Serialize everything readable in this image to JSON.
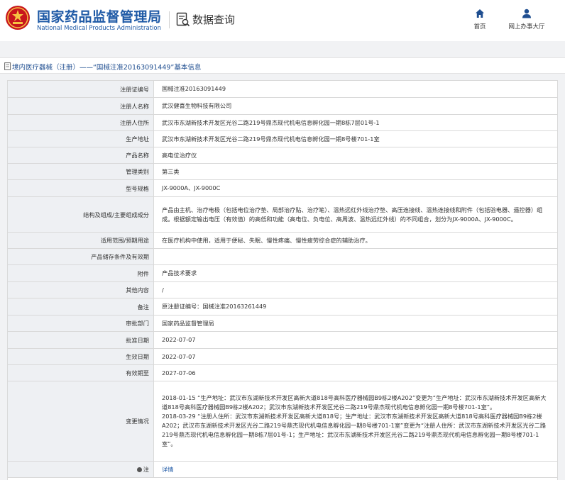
{
  "header": {
    "brand_cn": "国家药品监督管理局",
    "brand_en": "National Medical Products Administration",
    "query_title": "数据查询",
    "nav_home": "首页",
    "nav_hall": "网上办事大厅",
    "brand_color": "#1f5aa6"
  },
  "title_bar": {
    "text": "境内医疗器械（注册）——“国械注准20163091449”基本信息"
  },
  "rows": [
    {
      "label": "注册证编号",
      "value": "国械注准20163091449"
    },
    {
      "label": "注册人名称",
      "value": "武汉健喜生物科技有限公司"
    },
    {
      "label": "注册人住所",
      "value": "武汉市东湖新技术开发区光谷二路219号鼎杰现代机电信息孵化园一期8栋7层01号-1"
    },
    {
      "label": "生产地址",
      "value": "武汉市东湖新技术开发区光谷二路219号鼎杰现代机电信息孵化园一期8号楼701-1室"
    },
    {
      "label": "产品名称",
      "value": "高电位治疗仪"
    },
    {
      "label": "管理类别",
      "value": "第三类"
    },
    {
      "label": "型号规格",
      "value": "JX-9000A、JX-9000C"
    },
    {
      "label": "结构及组成/主要组成成分",
      "value": "产品由主机、治疗电极（包括电位治疗垫、局部治疗贴、治疗笔）、温热远红外线治疗垫、高压连接线、温热连接线和附件（包括验电器、遥控器）组成。根据额定输出电压（有效值）的高低和功能（高电位、负电位、高周波、温热远红外线）的不同组合，划分为JX-9000A、JX-9000C。"
    },
    {
      "label": "适用范围/预期用途",
      "value": "在医疗机构中使用，适用于便秘、失眠、慢性疼痛、慢性疲劳综合症的辅助治疗。"
    },
    {
      "label": "产品储存条件及有效期",
      "value": ""
    },
    {
      "label": "附件",
      "value": "产品技术要求"
    },
    {
      "label": "其他内容",
      "value": "/"
    },
    {
      "label": "备注",
      "value": "原注册证编号：国械注准20163261449"
    },
    {
      "label": "审批部门",
      "value": "国家药品监督管理局"
    },
    {
      "label": "批准日期",
      "value": "2022-07-07"
    },
    {
      "label": "生效日期",
      "value": "2022-07-07"
    },
    {
      "label": "有效期至",
      "value": "2027-07-06"
    },
    {
      "label": "变更情况",
      "value": "2018-01-15 “生产地址：武汉市东湖新技术开发区高新大道818号高科医疗器械园B9栋2楼A202”变更为“生产地址：武汉市东湖新技术开发区高新大道818号高科医疗器械园B9栋2楼A202；武汉市东湖新技术开发区光谷二路219号鼎杰现代机电信息孵化园一期8号楼701-1室”。\n2018-03-29 “注册人住所：武汉市东湖新技术开发区高新大道818号；生产地址：武汉市东湖新技术开发区高新大道818号高科医疗器械园B9栋2楼A202；武汉市东湖新技术开发区光谷二路219号鼎杰现代机电信息孵化园一期8号楼701-1室”变更为“注册人住所：武汉市东湖新技术开发区光谷二路219号鼎杰现代机电信息孵化园一期8栋7层01号-1；生产地址：武汉市东湖新技术开发区光谷二路219号鼎杰现代机电信息孵化园一期8号楼701-1室”。"
    },
    {
      "label": "注",
      "value": "详情",
      "is_link": true
    }
  ]
}
